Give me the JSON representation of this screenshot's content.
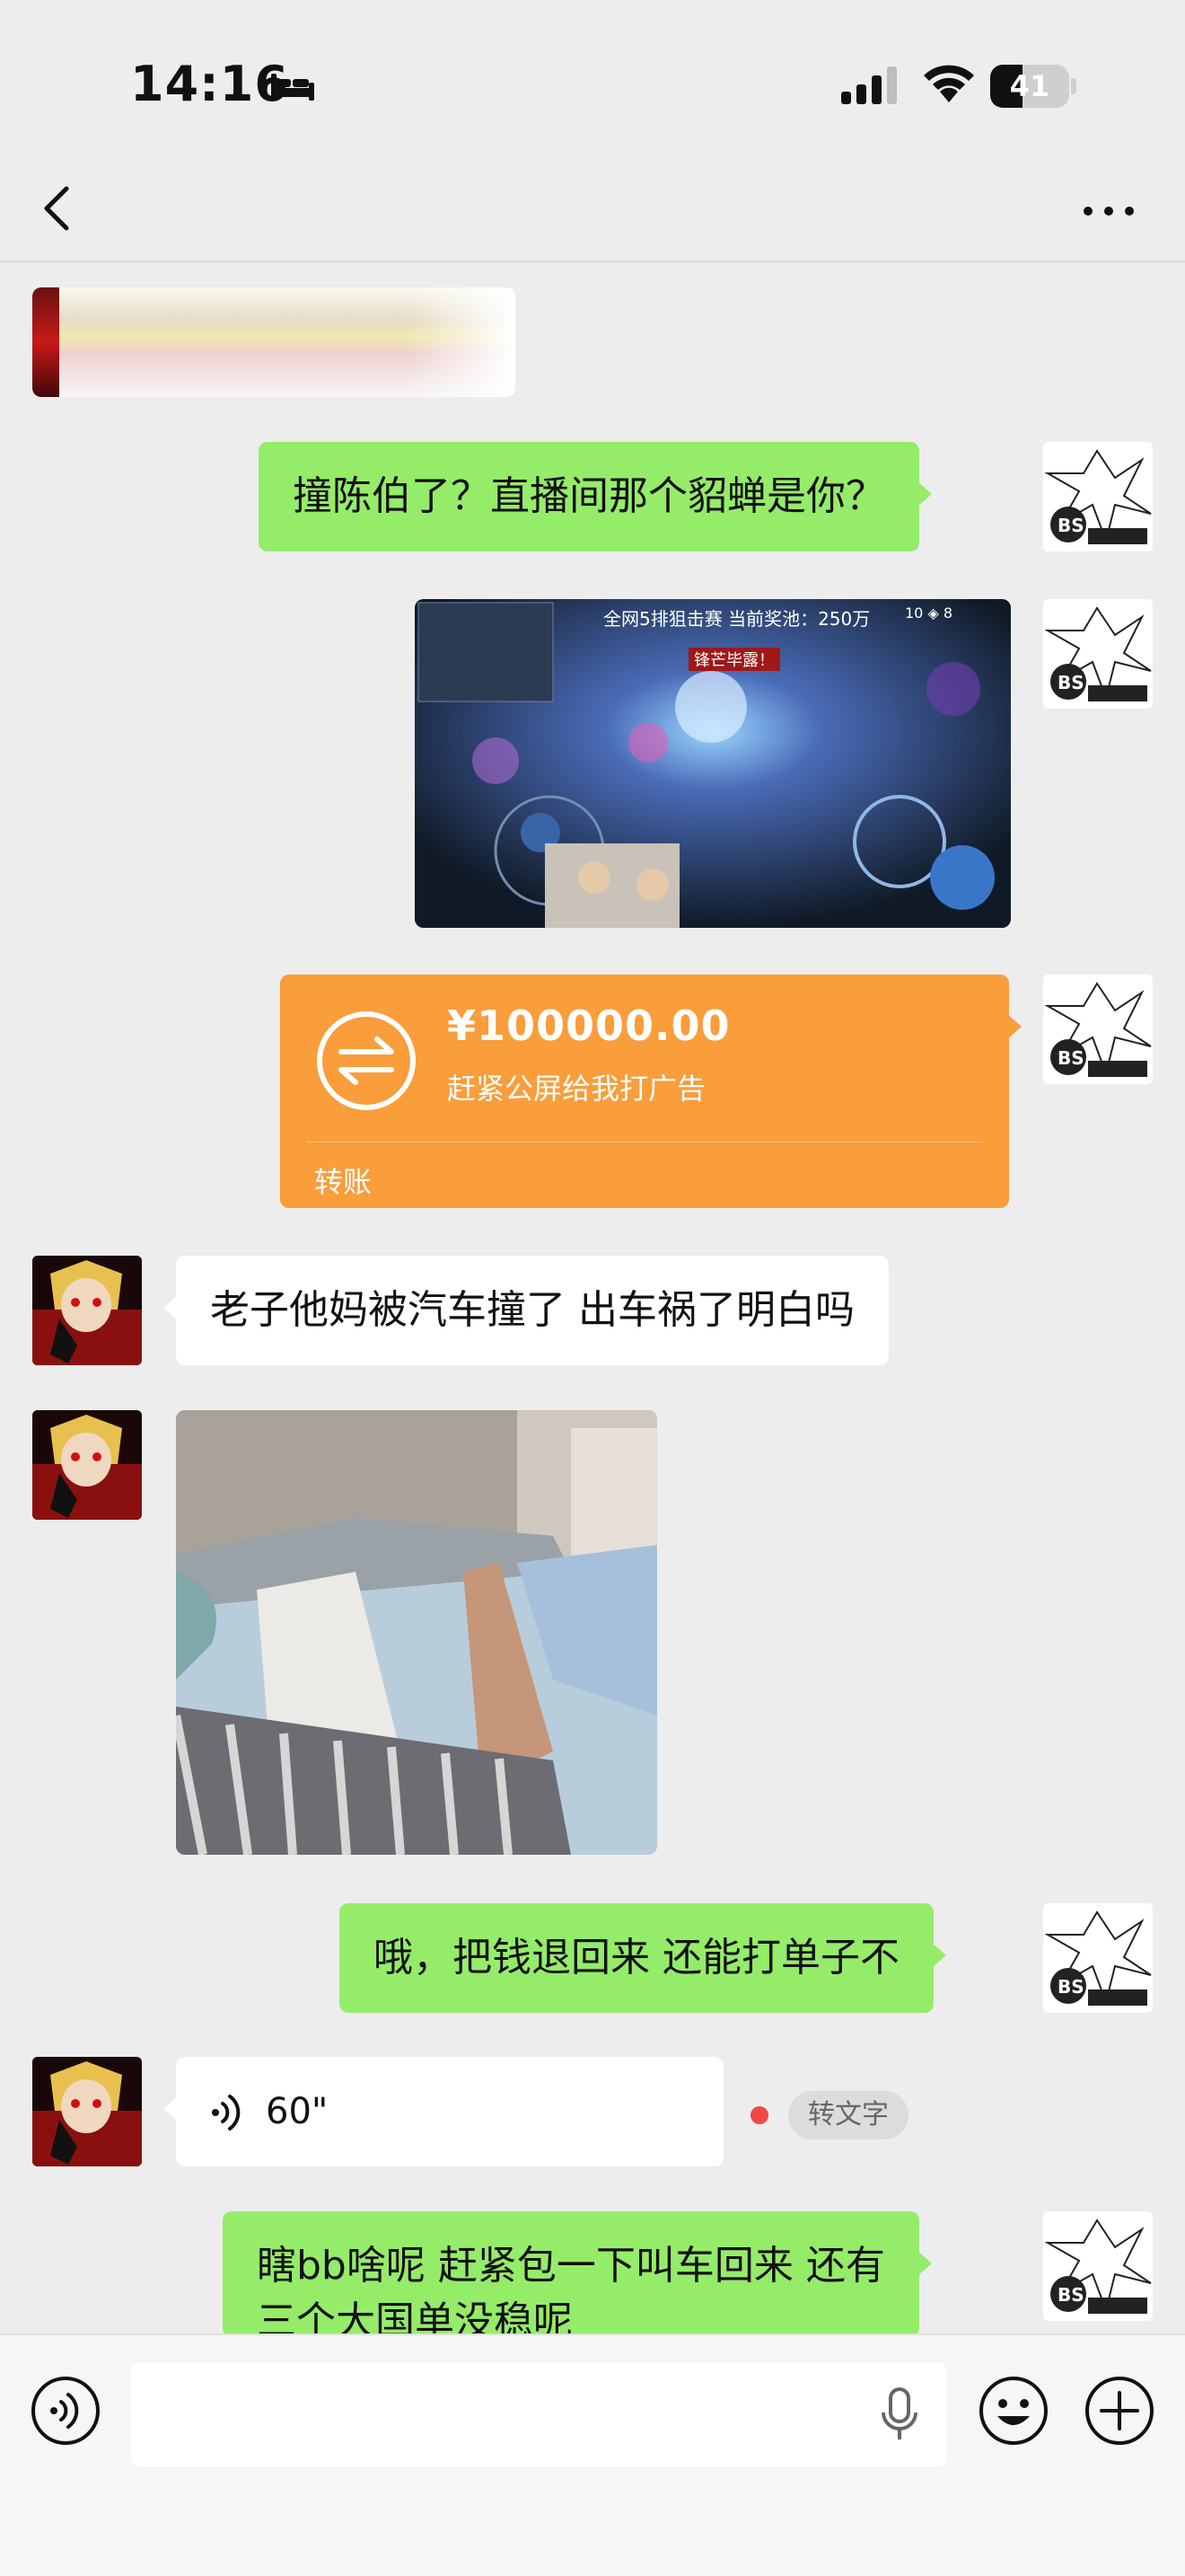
{
  "status_bar": {
    "time": "14:16",
    "battery_level": "41",
    "battery_fraction": 0.41
  },
  "nav": {
    "back_icon": "chevron-left-icon",
    "more_icon": "more-dots-icon"
  },
  "messages": [
    {
      "sender": "me",
      "type": "text",
      "text": "撞陈伯了？直播间那个貂蝉是你？"
    },
    {
      "sender": "me",
      "type": "image",
      "overlay_title": "全网5排狙击赛 当前奖池：250万",
      "overlay_score": "10 ◈ 8",
      "overlay_banner": "锋芒毕露！"
    },
    {
      "sender": "me",
      "type": "transfer",
      "amount": "¥100000.00",
      "note": "赶紧公屏给我打广告",
      "label": "转账"
    },
    {
      "sender": "other",
      "type": "text",
      "text": "老子他妈被汽车撞了 出车祸了明白吗"
    },
    {
      "sender": "other",
      "type": "image"
    },
    {
      "sender": "me",
      "type": "text",
      "text": "哦，把钱退回来 还能打单子不"
    },
    {
      "sender": "other",
      "type": "voice",
      "duration": "60\"",
      "to_text_label": "转文字"
    },
    {
      "sender": "me",
      "type": "text",
      "line1": "瞎bb啥呢 赶紧包一下叫车回来 还有",
      "line2": "三个大国单没稳呢"
    }
  ],
  "input_bar": {
    "voice_icon": "voice-mode-icon",
    "mic_icon": "microphone-icon",
    "emoji_icon": "emoji-icon",
    "plus_icon": "plus-circle-icon"
  },
  "colors": {
    "background": "#ededed",
    "my_bubble": "#95ec69",
    "other_bubble": "#ffffff",
    "transfer": "#fa9d3b",
    "unread_dot": "#f04848"
  }
}
